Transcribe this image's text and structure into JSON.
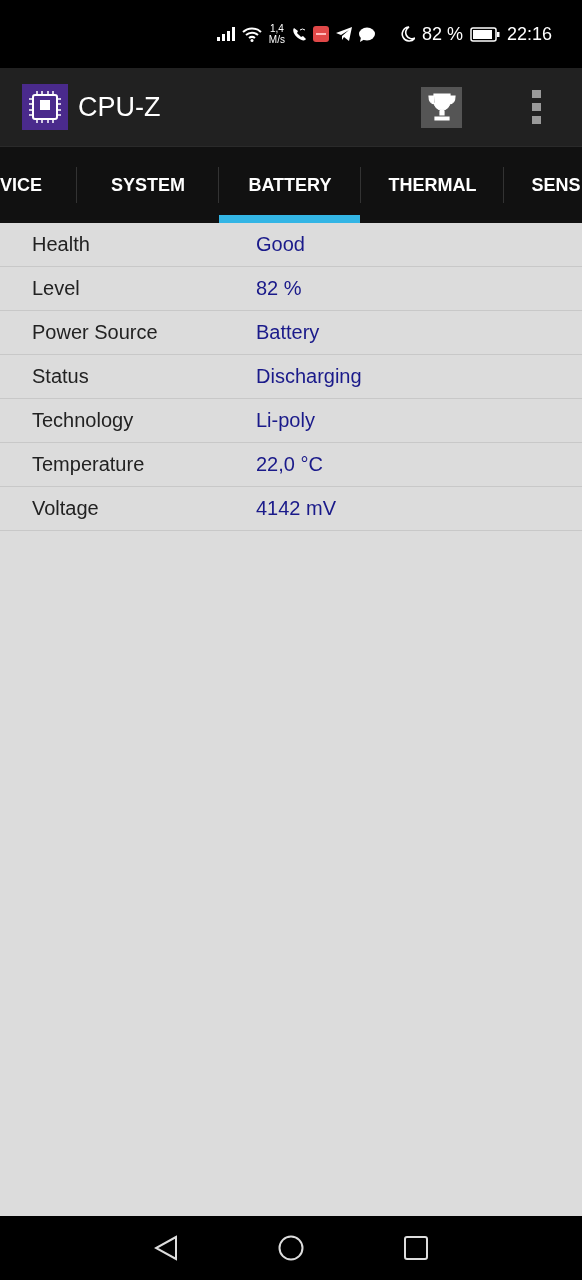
{
  "status_bar": {
    "speed_value": "1,4",
    "speed_unit": "M/s",
    "battery": "82 %",
    "time": "22:16"
  },
  "app_bar": {
    "title": "CPU-Z"
  },
  "tabs": [
    {
      "label": "VICE",
      "selected": false
    },
    {
      "label": "SYSTEM",
      "selected": false
    },
    {
      "label": "BATTERY",
      "selected": true
    },
    {
      "label": "THERMAL",
      "selected": false
    },
    {
      "label": "SENS",
      "selected": false
    }
  ],
  "rows": [
    {
      "label": "Health",
      "value": "Good"
    },
    {
      "label": "Level",
      "value": "82 %"
    },
    {
      "label": "Power Source",
      "value": "Battery"
    },
    {
      "label": "Status",
      "value": "Discharging"
    },
    {
      "label": "Technology",
      "value": "Li-poly"
    },
    {
      "label": "Temperature",
      "value": "22,0 °C"
    },
    {
      "label": "Voltage",
      "value": "4142 mV"
    }
  ]
}
